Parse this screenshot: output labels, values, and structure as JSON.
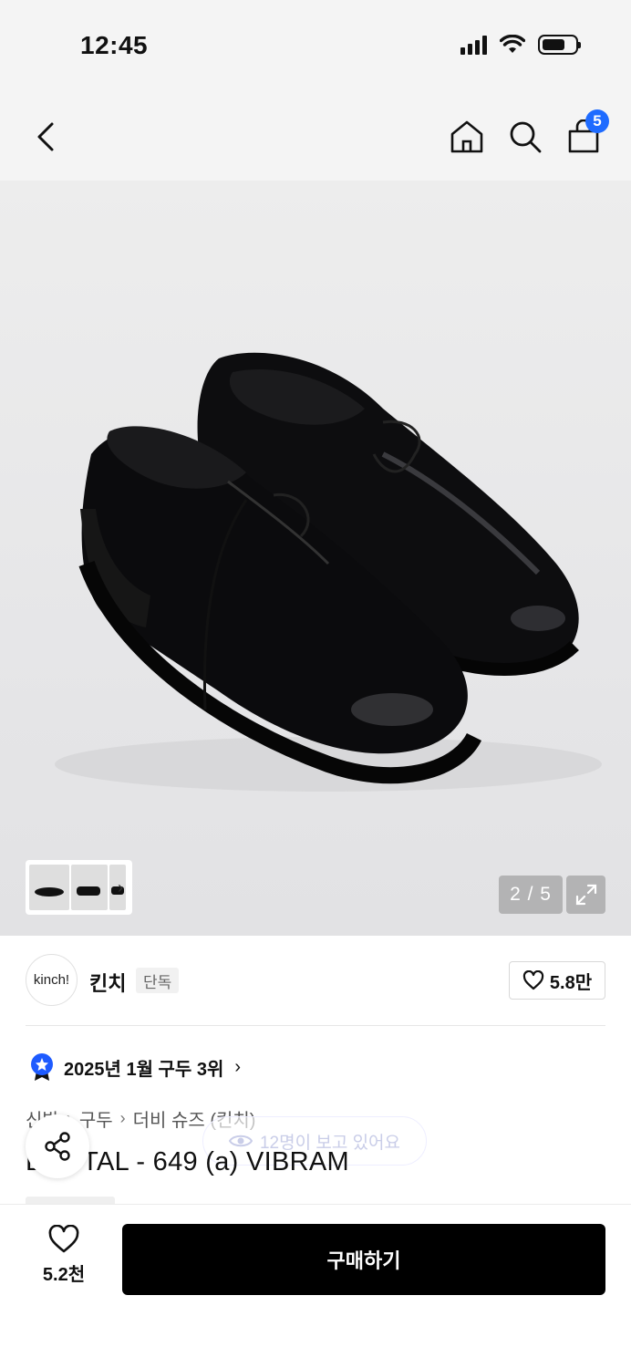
{
  "status_bar": {
    "time": "12:45"
  },
  "nav": {
    "cart_count": "5"
  },
  "gallery": {
    "counter": "2 / 5"
  },
  "brand": {
    "logo_text": "kinch!",
    "name": "킨치",
    "tag": "단독",
    "likes": "5.8만"
  },
  "ranking": {
    "text": "2025년 1월 구두 3위"
  },
  "breadcrumb": [
    "신발",
    "구두",
    "더비 슈즈 (킨치)"
  ],
  "viewers": {
    "text": "12명이 보고 있어요"
  },
  "product": {
    "title": "BRUTAL - 649 (a) VIBRAM"
  },
  "bottom": {
    "wish_count": "5.2천",
    "buy_label": "구매하기"
  },
  "colors": {
    "accent": "#1e6bff",
    "buy_bg": "#000000"
  }
}
